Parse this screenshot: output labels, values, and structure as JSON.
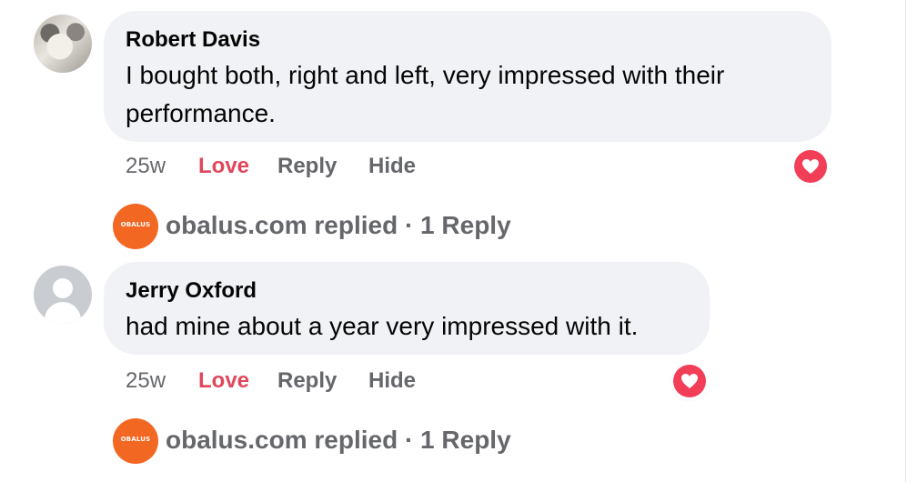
{
  "comments": [
    {
      "author": "Robert Davis",
      "text": "I bought both, right and left, very impressed with their performance.",
      "time": "25w",
      "love_label": "Love",
      "reply_label": "Reply",
      "hide_label": "Hide",
      "reaction": "love-heart-icon",
      "replied": {
        "page_name": "obalus.com replied · 1 Reply",
        "logo_text": "OBALUS"
      }
    },
    {
      "author": "Jerry Oxford",
      "text": "had mine about a year very impressed with it.",
      "time": "25w",
      "love_label": "Love",
      "reply_label": "Reply",
      "hide_label": "Hide",
      "reaction": "love-heart-icon",
      "replied": {
        "page_name": "obalus.com replied · 1 Reply",
        "logo_text": "OBALUS"
      }
    }
  ],
  "colors": {
    "bubble": "#f0f2f5",
    "love": "#e0475d",
    "muted": "#65676b",
    "page_logo": "#f26722"
  }
}
